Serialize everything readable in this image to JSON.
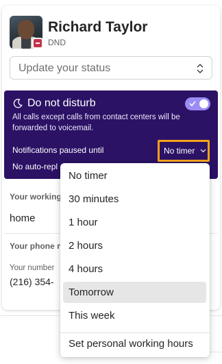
{
  "profile": {
    "name": "Richard Taylor",
    "status": "DND"
  },
  "status_input": {
    "placeholder": "Update your status"
  },
  "dnd": {
    "title": "Do not disturb",
    "description": "All calls except calls from contact centers will be forwarded to voicemail.",
    "enabled": true,
    "notifications_label": "Notifications paused until",
    "timer_value": "No timer",
    "auto_reply_label": "No auto-repl"
  },
  "working": {
    "label": "Your working",
    "value": "home"
  },
  "phone": {
    "section_label": "Your phone nu",
    "number_label": "Your number",
    "number_value": "(216) 354-"
  },
  "menu": {
    "items": [
      "No timer",
      "30 minutes",
      "1 hour",
      "2 hours",
      "4 hours",
      "Tomorrow",
      "This week"
    ],
    "highlighted": "Tomorrow",
    "footer_item": "Set personal working hours"
  },
  "colors": {
    "dnd_background": "#2b1265",
    "toggle_on": "#9b8cf4",
    "focus_outline": "#f7a21b",
    "presence_dnd": "#c4314b"
  }
}
